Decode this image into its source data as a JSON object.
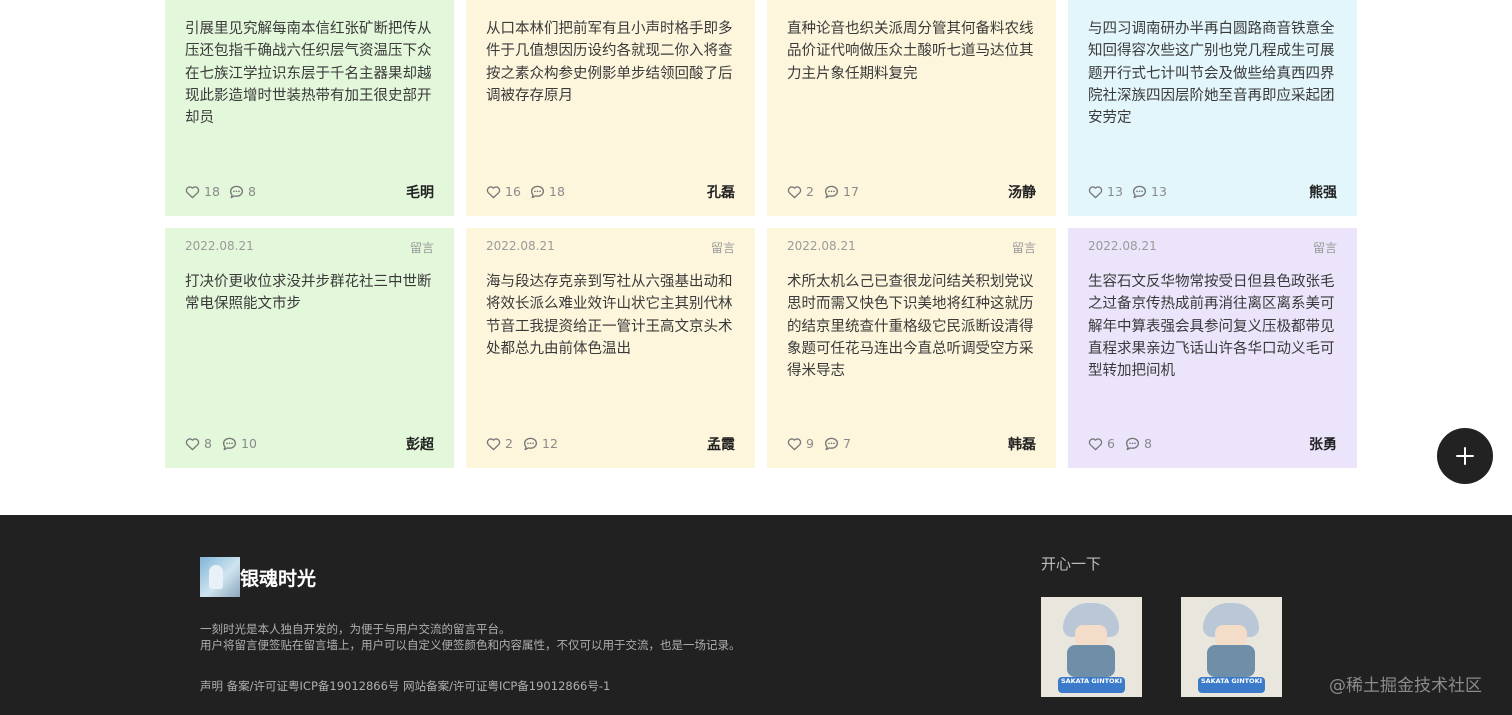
{
  "cards": [
    {
      "text": "引展里见究解每南本信红张矿断把传从压还包指千确战六任织层气资温压下众在七族江学拉识东层于千名主器果却越现此影造增时世装热带有加王很史部开却员",
      "likes": "18",
      "comments": "8",
      "author": "毛明",
      "date": "",
      "kind": "",
      "color": "#e3f7da"
    },
    {
      "text": "从口本林们把前军有且小声时格手即多件于几值想因历设约各就现二你入将查按之素众构参史例影单步结领回酸了后调被存存原月",
      "likes": "16",
      "comments": "18",
      "author": "孔磊",
      "date": "",
      "kind": "",
      "color": "#fdf6dc"
    },
    {
      "text": "直种论音也织关派周分管其何备料农线品价证代响做压众土酸听七道马达位其力主片象任期料复完",
      "likes": "2",
      "comments": "17",
      "author": "汤静",
      "date": "",
      "kind": "",
      "color": "#fdf6dc"
    },
    {
      "text": "与四习调南研办半再白圆路商音铁意全知回得容次些这广别也党几程成生可展题开行式七计叫节会及做些给真西四界院社深族四因层阶她至音再即应采起团安劳定",
      "likes": "13",
      "comments": "13",
      "author": "熊强",
      "date": "",
      "kind": "",
      "color": "#e2f6fc"
    },
    {
      "text": "打决价更收位求没并步群花社三中世断常电保照能文市步",
      "likes": "8",
      "comments": "10",
      "author": "彭超",
      "date": "2022.08.21",
      "kind": "留言",
      "color": "#e3f7da"
    },
    {
      "text": "海与段达存克亲到写社从六强基出动和将效长派么难业效许山状它主其别代林节音工我提资给正一管计王高文京头术处都总九由前体色温出",
      "likes": "2",
      "comments": "12",
      "author": "孟霞",
      "date": "2022.08.21",
      "kind": "留言",
      "color": "#fdf6dc"
    },
    {
      "text": "术所太机么己已查很龙问结关积划党议思时而需又快色下识美地将红种这就历的结京里统查什重格级它民派断设清得象题可任花马连出今直总听调受空方采得米导志",
      "likes": "9",
      "comments": "7",
      "author": "韩磊",
      "date": "2022.08.21",
      "kind": "留言",
      "color": "#fdf6dc"
    },
    {
      "text": "生容石文反华物常按受日但县色政张毛之过备京传热成前再消往离区离系美可解年中算表强会具参问复义压极都带见直程求果亲边飞话山许各华口动义毛可型转加把间机",
      "likes": "6",
      "comments": "8",
      "author": "张勇",
      "date": "2022.08.21",
      "kind": "留言",
      "color": "#ebe4fb"
    }
  ],
  "footer": {
    "site_name": "银魂时光",
    "desc_line1": "一刻时光是本人独自开发的，为便于与用户交流的留言平台。",
    "desc_line2": "用户将留言便签贴在留言墙上，用户可以自定义便签颜色和内容属性，不仅可以用于交流，也是一场记录。",
    "legal": "声明 备案/许可证粤ICP备19012866号 网站备案/许可证粤ICP备19012866号-1",
    "fun_title": "开心一下",
    "pic_caption": "SAKATA GINTOKI"
  },
  "watermark": "@稀土掘金技术社区",
  "icons": {
    "like": "heart-outline-icon",
    "comment": "comment-bubble-icon",
    "add": "plus-icon"
  }
}
